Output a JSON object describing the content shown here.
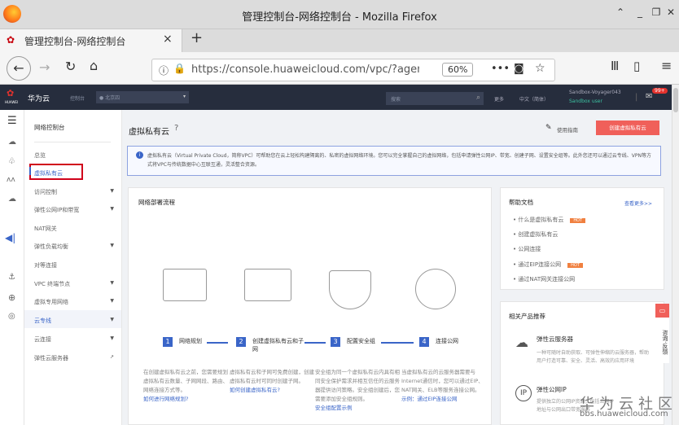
{
  "browser": {
    "window_title": "管理控制台-网络控制台 - Mozilla Firefox",
    "tab_title": "管理控制台-网络控制台",
    "url": "https://console.huaweicloud.com/vpc/?agen",
    "zoom": "60%",
    "new_tab": "+",
    "tab_close": "×"
  },
  "header": {
    "brand": "华为云",
    "logo_text": "HUAWEI",
    "console": "控制台",
    "region": "北京四",
    "search_placeholder": "搜索",
    "more": "更多",
    "language": "中文（简体）",
    "username": "Sandbox-Voyager043",
    "user_role": "Sandbox user",
    "badge": "99+"
  },
  "sidebar": {
    "title": "网络控制台",
    "items": [
      {
        "label": "总览",
        "arrow": false
      },
      {
        "label": "虚拟私有云",
        "arrow": false,
        "active": true
      },
      {
        "label": "访问控制",
        "arrow": true
      },
      {
        "label": "弹性公网IP和带宽",
        "arrow": true
      },
      {
        "label": "NAT网关",
        "arrow": false
      },
      {
        "label": "弹性负载均衡",
        "arrow": true
      },
      {
        "label": "对等连接",
        "arrow": false
      },
      {
        "label": "VPC 终端节点",
        "arrow": true
      },
      {
        "label": "虚拟专用网络",
        "arrow": true
      },
      {
        "label": "云专线",
        "arrow": true
      },
      {
        "label": "云连接",
        "arrow": true
      },
      {
        "label": "弹性云服务器",
        "arrow": false
      }
    ]
  },
  "page": {
    "title": "虚拟私有云",
    "guide": "使用指南",
    "create_button": "创建虚拟私有云",
    "info": "虚拟私有云（Virtual Private Cloud，简称VPC）可帮助您在云上轻松构建隔离的、私密的虚拟网络环境。您可以完全掌握自己的虚拟网络，包括申请弹性公网IP、带宽、创建子网、设置安全组等。此外您还可以通过云专线、VPN等方式将VPC与传统数据中心互联互通，灵活整合资源。"
  },
  "flow": {
    "title": "网络部署流程",
    "steps": [
      {
        "num": "1",
        "label": "网络规划",
        "desc": "在创建虚拟私有云之前，您需要规划虚拟私有云数量、子网网段、路由、网络连接方式等。",
        "link": "如何进行网络规划?"
      },
      {
        "num": "2",
        "label": "创建虚拟私有云和子网",
        "desc": "虚拟私有云和子网可免费创建，创建虚拟私有云时可同时创建子网。",
        "link": "如何创建虚拟私有云?"
      },
      {
        "num": "3",
        "label": "配置安全组",
        "desc": "安全组为同一个虚拟私有云内具有相同安全保护需求并相互信任的云服务器提供访问策略。安全组创建后，您需要添加安全组规则。",
        "link": "安全组配置示例"
      },
      {
        "num": "4",
        "label": "连接公网",
        "desc": "当虚拟私有云的云服务器需要与Internet通信时，您可以通过EIP、NAT网关、ELB等服务连接公网。",
        "link": "示例：通过EIP连接公网"
      }
    ]
  },
  "help": {
    "title": "帮助文档",
    "more": "查看更多>>",
    "hot_label": "HOT",
    "items": [
      {
        "label": "什么是虚拟私有云",
        "hot": true
      },
      {
        "label": "创建虚拟私有云",
        "hot": false
      },
      {
        "label": "公网连接",
        "hot": false
      },
      {
        "label": "通过EIP连接公网",
        "hot": true
      },
      {
        "label": "通过NAT网关连接公网",
        "hot": false
      }
    ]
  },
  "products": {
    "title": "相关产品推荐",
    "items": [
      {
        "name": "弹性云服务器",
        "desc": "一种可随时自助获取、可弹性伸缩的云服务器，帮助用户打造可靠、安全、灵活、高效的应用环境"
      },
      {
        "name": "弹性公网IP",
        "desc": "提供独立的公网IP资源，包括公网IP地址与公网出口带宽服务"
      }
    ]
  },
  "feedback": "咨询·反馈",
  "watermark": {
    "title": "华为云社区",
    "url": "bbs.huaweicloud.com"
  }
}
